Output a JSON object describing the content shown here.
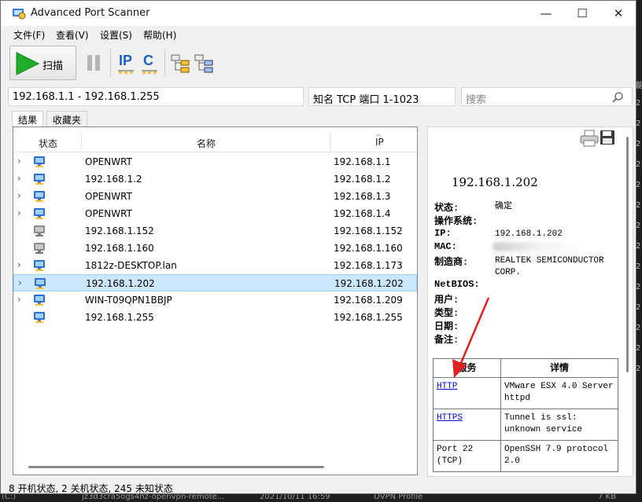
{
  "window": {
    "title": "Advanced Port Scanner",
    "minimize": "—",
    "maximize": "☐",
    "close": "✕"
  },
  "menu": [
    "文件(F)",
    "查看(V)",
    "设置(S)",
    "帮助(H)"
  ],
  "toolbar": {
    "scan_label": "扫描",
    "ip_label": "IP",
    "c_label": "C"
  },
  "address": {
    "range": "192.168.1.1 - 192.168.1.255",
    "ports": "知名 TCP 端口 1-1023",
    "search_placeholder": "搜索"
  },
  "tabs": [
    "结果",
    "收藏夹"
  ],
  "list": {
    "columns": [
      "状态",
      "名称",
      "IP"
    ],
    "rows": [
      {
        "name": "OPENWRT",
        "ip": "192.168.1.1",
        "expandable": true,
        "status": "on"
      },
      {
        "name": "192.168.1.2",
        "ip": "192.168.1.2",
        "expandable": true,
        "status": "on"
      },
      {
        "name": "OPENWRT",
        "ip": "192.168.1.3",
        "expandable": true,
        "status": "on"
      },
      {
        "name": "OPENWRT",
        "ip": "192.168.1.4",
        "expandable": true,
        "status": "on"
      },
      {
        "name": "192.168.1.152",
        "ip": "192.168.1.152",
        "expandable": false,
        "status": "off"
      },
      {
        "name": "192.168.1.160",
        "ip": "192.168.1.160",
        "expandable": false,
        "status": "off"
      },
      {
        "name": "1812z-DESKTOP.lan",
        "ip": "192.168.1.173",
        "expandable": true,
        "status": "on"
      },
      {
        "name": "192.168.1.202",
        "ip": "192.168.1.202",
        "expandable": true,
        "status": "on",
        "selected": true
      },
      {
        "name": "WIN-T09QPN1BBJP",
        "ip": "192.168.1.209",
        "expandable": true,
        "status": "on"
      },
      {
        "name": "192.168.1.255",
        "ip": "192.168.1.255",
        "expandable": false,
        "status": "on"
      }
    ]
  },
  "detail": {
    "ip": "192.168.1.202",
    "fields": [
      {
        "key": "状态:",
        "value": "确定"
      },
      {
        "key": "操作系统:",
        "value": ""
      },
      {
        "key": "IP:",
        "value": "192.168.1.202"
      },
      {
        "key": "MAC:",
        "value": ""
      },
      {
        "key": "制造商:",
        "value": "REALTEK SEMICONDUCTOR CORP."
      },
      {
        "key": "NetBIOS:",
        "value": ""
      },
      {
        "key": "用户:",
        "value": ""
      },
      {
        "key": "类型:",
        "value": ""
      },
      {
        "key": "日期:",
        "value": ""
      },
      {
        "key": "备注:",
        "value": ""
      }
    ],
    "services_header": [
      "服务",
      "详情"
    ],
    "services": [
      {
        "service": "HTTP",
        "detail": "VMware ESX 4.0 Server httpd",
        "link": true
      },
      {
        "service": "HTTPS",
        "detail": "Tunnel is ssl: unknown service",
        "link": true
      },
      {
        "service": "Port 22 (TCP)",
        "detail": "OpenSSH 7.9 protocol 2.0",
        "link": false
      }
    ]
  },
  "status": "8 开机状态, 2 关机状态, 245 未知状态",
  "background": {
    "bottom_items": [
      "(C:)",
      "jz3d3cra5ogs4nz-openvpn-remote...",
      "2021/10/11 16:59",
      "OVPN Profile",
      "7 KB"
    ],
    "right_chars": [
      "能",
      "2",
      "2",
      "2",
      "2",
      "2",
      "2",
      "2",
      "2",
      "2",
      "2",
      "2",
      "2",
      "2",
      "2"
    ]
  },
  "colors": {
    "selection": "#cce8ff",
    "link": "#0000cc",
    "arrow": "#e02020",
    "scan_green": "#1fae2a"
  }
}
